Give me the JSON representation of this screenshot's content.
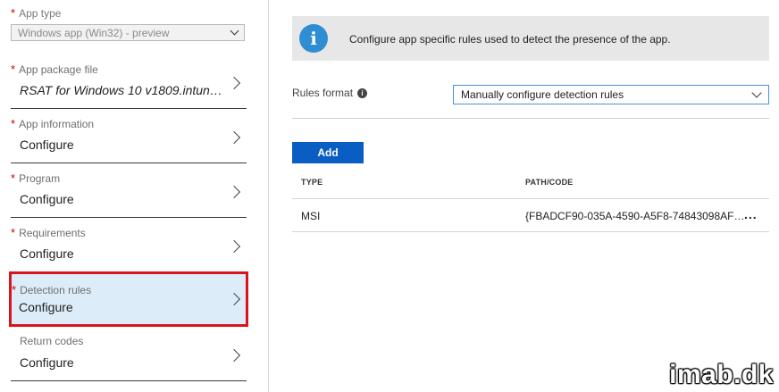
{
  "left_panel": {
    "app_type": {
      "label": "App type",
      "value": "Windows app (Win32) - preview",
      "required_mark": "*"
    },
    "items": [
      {
        "title": "App package file",
        "value": "RSAT for Windows 10 v1809.intun…",
        "required": true,
        "selected": false
      },
      {
        "title": "App information",
        "value": "Configure",
        "required": true,
        "selected": false
      },
      {
        "title": "Program",
        "value": "Configure",
        "required": true,
        "selected": false
      },
      {
        "title": "Requirements",
        "value": "Configure",
        "required": true,
        "selected": false
      },
      {
        "title": "Detection rules",
        "value": "Configure",
        "required": true,
        "selected": true
      },
      {
        "title": "Return codes",
        "value": "Configure",
        "required": false,
        "selected": false
      }
    ]
  },
  "right_panel": {
    "info_icon": "info-icon",
    "info_text": "Configure app specific rules used to detect the presence of the app.",
    "rules_format_label": "Rules format",
    "rules_format_value": "Manually configure detection rules",
    "add_label": "Add",
    "table": {
      "headers": [
        "TYPE",
        "PATH/CODE"
      ],
      "rows": [
        {
          "type": "MSI",
          "path": "{FBADCF90-035A-4590-A5F8-74843098AF…",
          "more": "..."
        }
      ]
    }
  },
  "watermark": "imab.dk",
  "colors": {
    "accent": "#0a5dc2",
    "selection_bg": "#dcecf9",
    "highlight_border": "#d9141c",
    "required": "#cc0000",
    "info_icon": "#2f8ed3"
  }
}
